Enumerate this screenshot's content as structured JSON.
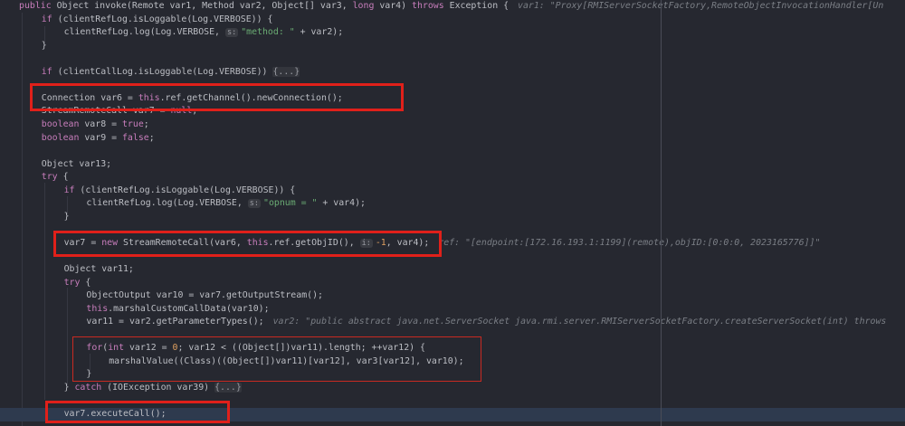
{
  "colors": {
    "background": "#262830",
    "keyword": "#c77dbb",
    "string": "#6aab73",
    "number": "#e0a060",
    "hint": "#7a7e85",
    "highlight_box": "#e0201a",
    "current_line": "#2e3a4e"
  },
  "lines": [
    {
      "indent": 0,
      "tokens": [
        [
          "k",
          "public"
        ],
        [
          "t",
          " Object invoke(Remote var1, Method var2, Object[] var3, "
        ],
        [
          "k",
          "long"
        ],
        [
          "t",
          " var4) "
        ],
        [
          "k",
          "throws"
        ],
        [
          "t",
          " Exception {"
        ],
        [
          "c",
          "var1: \"Proxy[RMIServerSocketFactory,RemoteObjectInvocationHandler[Un"
        ]
      ]
    },
    {
      "indent": 1,
      "tokens": [
        [
          "k",
          "if"
        ],
        [
          "t",
          " (clientRefLog.isLoggable(Log.VERBOSE)) {"
        ]
      ]
    },
    {
      "indent": 2,
      "tokens": [
        [
          "t",
          "clientRefLog.log(Log.VERBOSE, "
        ],
        [
          "h",
          "s:"
        ],
        [
          "s",
          "\"method: \""
        ],
        [
          "t",
          " + var2);"
        ]
      ]
    },
    {
      "indent": 1,
      "tokens": [
        [
          "t",
          "}"
        ]
      ]
    },
    {
      "indent": 0,
      "tokens": []
    },
    {
      "indent": 1,
      "tokens": [
        [
          "k",
          "if"
        ],
        [
          "t",
          " (clientCallLog.isLoggable(Log.VERBOSE)) "
        ],
        [
          "f",
          "{...}"
        ]
      ]
    },
    {
      "indent": 0,
      "tokens": []
    },
    {
      "indent": 1,
      "tokens": [
        [
          "t",
          "Connection var6 = "
        ],
        [
          "k",
          "this"
        ],
        [
          "t",
          ".ref.getChannel().newConnection();"
        ]
      ]
    },
    {
      "indent": 1,
      "tokens": [
        [
          "t",
          "StreamRemoteCall var7 = "
        ],
        [
          "k",
          "null"
        ],
        [
          "t",
          ";"
        ]
      ]
    },
    {
      "indent": 1,
      "tokens": [
        [
          "k",
          "boolean"
        ],
        [
          "t",
          " var8 = "
        ],
        [
          "k",
          "true"
        ],
        [
          "t",
          ";"
        ]
      ]
    },
    {
      "indent": 1,
      "tokens": [
        [
          "k",
          "boolean"
        ],
        [
          "t",
          " var9 = "
        ],
        [
          "k",
          "false"
        ],
        [
          "t",
          ";"
        ]
      ]
    },
    {
      "indent": 0,
      "tokens": []
    },
    {
      "indent": 1,
      "tokens": [
        [
          "t",
          "Object var13;"
        ]
      ]
    },
    {
      "indent": 1,
      "tokens": [
        [
          "k",
          "try"
        ],
        [
          "t",
          " {"
        ]
      ]
    },
    {
      "indent": 2,
      "tokens": [
        [
          "k",
          "if"
        ],
        [
          "t",
          " (clientRefLog.isLoggable(Log.VERBOSE)) {"
        ]
      ]
    },
    {
      "indent": 3,
      "tokens": [
        [
          "t",
          "clientRefLog.log(Log.VERBOSE, "
        ],
        [
          "h",
          "s:"
        ],
        [
          "s",
          "\"opnum = \""
        ],
        [
          "t",
          " + var4);"
        ]
      ]
    },
    {
      "indent": 2,
      "tokens": [
        [
          "t",
          "}"
        ]
      ]
    },
    {
      "indent": 0,
      "tokens": []
    },
    {
      "indent": 2,
      "tokens": [
        [
          "t",
          "var7 = "
        ],
        [
          "k",
          "new"
        ],
        [
          "t",
          " StreamRemoteCall(var6, "
        ],
        [
          "k",
          "this"
        ],
        [
          "t",
          ".ref.getObjID(), "
        ],
        [
          "h",
          "i:"
        ],
        [
          "n",
          "-1"
        ],
        [
          "t",
          ", var4);"
        ],
        [
          "c",
          "ref: \"[endpoint:[172.16.193.1:1199](remote),objID:[0:0:0, 2023165776]]\""
        ]
      ]
    },
    {
      "indent": 0,
      "tokens": []
    },
    {
      "indent": 2,
      "tokens": [
        [
          "t",
          "Object var11;"
        ]
      ]
    },
    {
      "indent": 2,
      "tokens": [
        [
          "k",
          "try"
        ],
        [
          "t",
          " {"
        ]
      ]
    },
    {
      "indent": 3,
      "tokens": [
        [
          "t",
          "ObjectOutput var10 = var7.getOutputStream();"
        ]
      ]
    },
    {
      "indent": 3,
      "tokens": [
        [
          "k",
          "this"
        ],
        [
          "t",
          ".marshalCustomCallData(var10);"
        ]
      ]
    },
    {
      "indent": 3,
      "tokens": [
        [
          "t",
          "var11 = var2.getParameterTypes();"
        ],
        [
          "c",
          "var2: \"public abstract java.net.ServerSocket java.rmi.server.RMIServerSocketFactory.createServerSocket(int) throws"
        ]
      ]
    },
    {
      "indent": 0,
      "tokens": []
    },
    {
      "indent": 3,
      "tokens": [
        [
          "k",
          "for"
        ],
        [
          "t",
          "("
        ],
        [
          "k",
          "int"
        ],
        [
          "t",
          " var12 = "
        ],
        [
          "n",
          "0"
        ],
        [
          "t",
          "; var12 < ((Object[])var11).length; ++var12) {"
        ]
      ]
    },
    {
      "indent": 4,
      "tokens": [
        [
          "t",
          "marshalValue((Class)((Object[])var11)[var12], var3[var12], var10);"
        ]
      ]
    },
    {
      "indent": 3,
      "tokens": [
        [
          "t",
          "}"
        ]
      ]
    },
    {
      "indent": 2,
      "tokens": [
        [
          "t",
          "} "
        ],
        [
          "k",
          "catch"
        ],
        [
          "t",
          " (IOException var39) "
        ],
        [
          "f",
          "{...}"
        ]
      ]
    },
    {
      "indent": 0,
      "tokens": []
    },
    {
      "indent": 2,
      "current": true,
      "tokens": [
        [
          "t",
          "var7.executeCall();"
        ]
      ]
    }
  ]
}
